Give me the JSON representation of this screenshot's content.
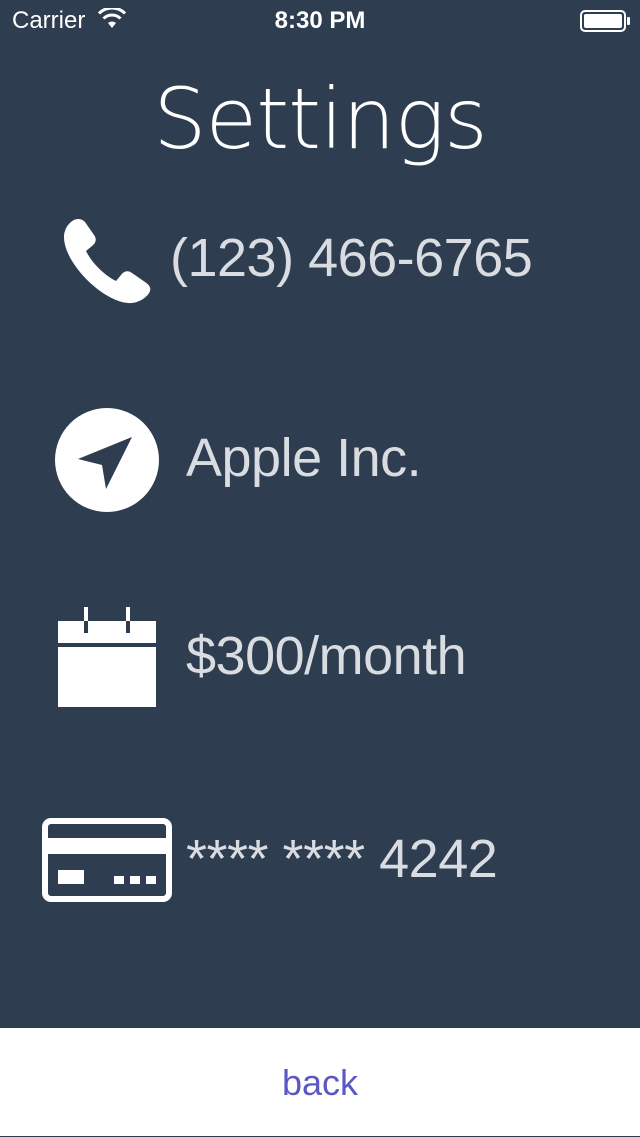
{
  "status_bar": {
    "carrier": "Carrier",
    "time": "8:30 PM",
    "wifi_icon": "wifi-icon",
    "battery_icon": "battery-icon"
  },
  "page": {
    "title": "Settings"
  },
  "rows": [
    {
      "icon": "phone-icon",
      "value": "(123) 466-6765"
    },
    {
      "icon": "location-arrow-icon",
      "value": "Apple Inc."
    },
    {
      "icon": "calendar-icon",
      "value": "$300/month"
    },
    {
      "icon": "credit-card-icon",
      "value": "**** **** 4242"
    }
  ],
  "footer": {
    "back_label": "back"
  },
  "colors": {
    "background": "#2e3d50",
    "text": "#ffffff",
    "value_text": "#d9dde2",
    "footer_background": "#ffffff",
    "back_link": "#5a57c7"
  }
}
